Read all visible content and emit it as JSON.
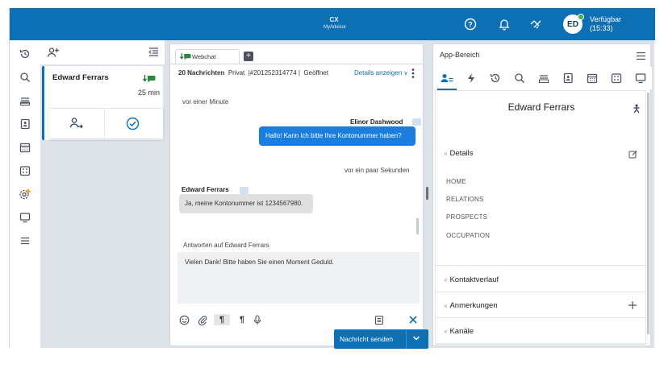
{
  "topbar": {
    "brand_top": "CX",
    "brand_bottom": "MyAdvisor",
    "status_line1": "Verfügbar",
    "status_line2": "(15:33)",
    "avatar_initials": "ED",
    "accent": "#0d6fb4"
  },
  "conversation": {
    "name": "Edward Ferrars",
    "time": "25 min"
  },
  "chat": {
    "tab_label": "Webchat",
    "message_count": "20 Nachrichten",
    "privacy": "Privat",
    "ticket": "|#201252314774 |",
    "state": "Geöffnet",
    "details_link": "Details anzeigen",
    "time1": "vor einer Minute",
    "agent_name": "Elinor Dashwood",
    "agent_message": "Hallo! Kann ich bitte Ihre Kontonummer haben?",
    "time2": "vor ein paar Sekunden",
    "customer_name": "Edward Ferrars",
    "customer_message": "Ja, meine Kontonummer ist 1234567980.",
    "reply_to": "Antworten auf Edward Ferrars",
    "draft": "Vielen Dank! Bitte haben Sie einen Moment Geduld.",
    "send_label": "Nachricht senden"
  },
  "app": {
    "title": "App-Bereich",
    "contact_name": "Edward Ferrars",
    "details_header": "Details",
    "fields": [
      "HOME",
      "RELATIONS",
      "PROSPECTS",
      "OCCUPATION"
    ],
    "sections": [
      "Kontaktverlauf",
      "Anmerkungen",
      "Kanäle"
    ]
  }
}
